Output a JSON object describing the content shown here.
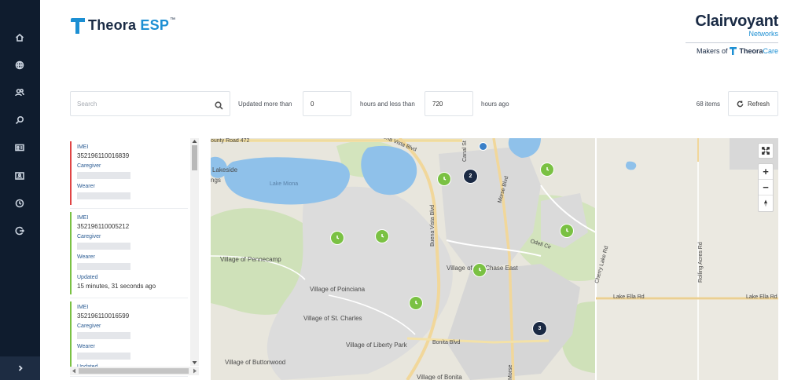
{
  "brand": {
    "name_part1": "Theora",
    "name_part2": "ESP",
    "trademark": "™"
  },
  "partner": {
    "name": "Clairvoyant",
    "sub": "Networks",
    "makers_prefix": "Makers of",
    "makers_brand": "Theora",
    "makers_brand_suffix": "Care"
  },
  "sidebar": {
    "icons": [
      "home-icon",
      "globe-icon",
      "users-icon",
      "search-icon",
      "id-card-icon",
      "badge-icon",
      "clock-icon",
      "logout-icon"
    ],
    "expand_icon": "chevron-right-icon"
  },
  "filters": {
    "search_placeholder": "Search",
    "updated_more_than_label": "Updated more than",
    "more_than_value": "0",
    "hours_less_than_label": "hours and less than",
    "less_than_value": "720",
    "hours_ago_label": "hours ago",
    "items_count": "68 items",
    "refresh_label": "Refresh"
  },
  "devices": [
    {
      "imei_label": "IMEI",
      "imei": "352196110016839",
      "caregiver_label": "Caregiver",
      "wearer_label": "Wearer",
      "status_color": "#e04545"
    },
    {
      "imei_label": "IMEI",
      "imei": "352196110005212",
      "caregiver_label": "Caregiver",
      "wearer_label": "Wearer",
      "updated_label": "Updated",
      "updated_value": "15 minutes, 31 seconds ago",
      "status_color": "#7ac143"
    },
    {
      "imei_label": "IMEI",
      "imei": "352196110016599",
      "caregiver_label": "Caregiver",
      "wearer_label": "Wearer",
      "updated_label": "Updated",
      "status_color": "#7ac143"
    }
  ],
  "map": {
    "labels": {
      "county_road": "ounty Road 472",
      "buena_vista_top": "Buena Vista Blvd",
      "lakeside": "Lakeside",
      "ngs": "ngs",
      "lake_miona": "Lake Miona",
      "canal_st": "Canal St",
      "morse_blvd": "Morse Blvd",
      "buena_vista_blvd": "Buena Vista Blvd",
      "odell_cir": "Odell Cir",
      "cherry_lake_rd": "Cherry Lake Rd",
      "rolling_acres_rd": "Rolling Acres Rd",
      "pennecamp": "Village of Pennecamp",
      "chase_east": "Village of Hal Chase East",
      "poinciana": "Village of Poinciana",
      "lake_ella_rd_1": "Lake Ella Rd",
      "lake_ella_rd_2": "Lake Ella Rd",
      "st_charles": "Village of St. Charles",
      "liberty_park": "Village of Liberty Park",
      "bonita_blvd": "Bonita Blvd",
      "buttonwood": "Village of Buttonwood",
      "bonita": "Village of Bonita",
      "morse_bottom": "Morse"
    },
    "clusters": [
      "2",
      "3"
    ],
    "controls": {
      "fullscreen_icon": "expand-icon",
      "zoom_in": "+",
      "zoom_out": "−",
      "compass_icon": "compass-icon"
    },
    "marker_color": "#7ac143",
    "cluster_color": "#1b2a44"
  }
}
